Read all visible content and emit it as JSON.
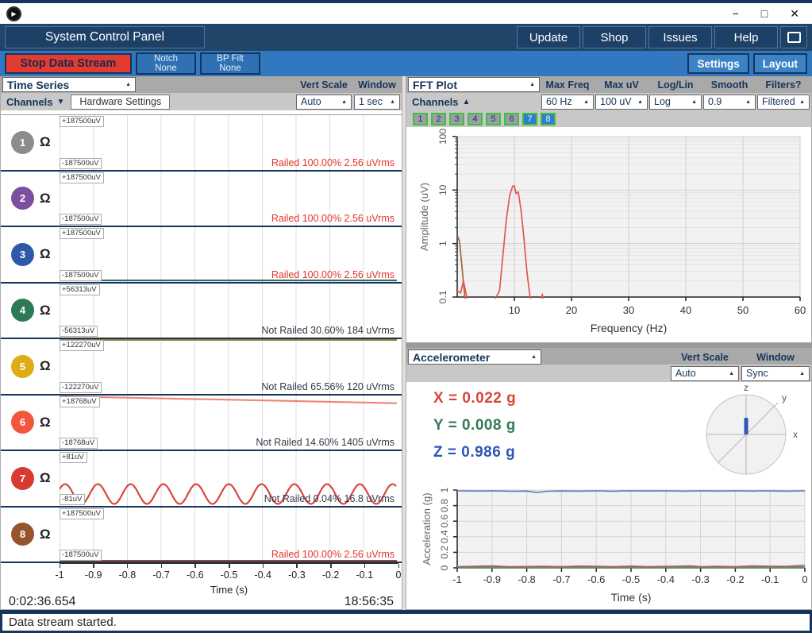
{
  "icons": {
    "play": "▶",
    "minimize": "−",
    "maximize": "□",
    "close": "✕",
    "arrow_up": "▲",
    "arrow_down": "▼",
    "ellipsis": "..."
  },
  "header": {
    "title": "System Control Panel",
    "buttons": [
      "Update",
      "Shop",
      "Issues",
      "Help"
    ]
  },
  "toolbar": {
    "stop_button": "Stop Data Stream",
    "notch_label": "Notch",
    "notch_value": "None",
    "bp_label": "BP Filt",
    "bp_value": "None",
    "settings": "Settings",
    "layout": "Layout"
  },
  "time_series": {
    "title": "Time Series",
    "vert_scale_label": "Vert Scale",
    "window_label": "Window",
    "vert_scale_value": "Auto",
    "window_value": "1 sec",
    "channels_label": "Channels",
    "hardware_settings": "Hardware Settings",
    "impedance_symbol": "Ω",
    "channels": [
      {
        "num": "1",
        "color": "#8c8c8c",
        "scale_top": "+187500uV",
        "scale_bottom": "-187500uV",
        "status": "Railed 100.00% 2.56 uVrms",
        "railed": true,
        "trace": {
          "type": "none",
          "color": "#16355a"
        }
      },
      {
        "num": "2",
        "color": "#7d4d9e",
        "scale_top": "+187500uV",
        "scale_bottom": "-187500uV",
        "status": "Railed 100.00% 2.56 uVrms",
        "railed": true,
        "trace": {
          "type": "none",
          "color": "#16355a"
        }
      },
      {
        "num": "3",
        "color": "#2c5aa8",
        "scale_top": "+187500uV",
        "scale_bottom": "-187500uV",
        "status": "Railed 100.00% 2.56 uVrms",
        "railed": true,
        "trace": {
          "type": "flat-bottom",
          "color": "#2d6d68"
        }
      },
      {
        "num": "4",
        "color": "#2c7a57",
        "scale_top": "+56313uV",
        "scale_bottom": "-56313uV",
        "status": "Not Railed 30.60% 184 uVrms",
        "railed": false,
        "trace": {
          "type": "none",
          "color": "#16355a"
        }
      },
      {
        "num": "5",
        "color": "#dfac17",
        "scale_top": "+122270uV",
        "scale_bottom": "-122270uV",
        "status": "Not Railed 65.56% 120 uVrms",
        "railed": false,
        "trace": {
          "type": "flat-top",
          "color": "#8f7d2a"
        }
      },
      {
        "num": "6",
        "color": "#f2573e",
        "scale_top": "+18768uV",
        "scale_bottom": "-18768uV",
        "status": "Not Railed 14.60% 1405 uVrms",
        "railed": false,
        "trace": {
          "type": "slope",
          "color": "#ef8673",
          "from": 1,
          "to": 10
        }
      },
      {
        "num": "7",
        "color": "#d63a32",
        "scale_top": "+81uV",
        "scale_bottom": "-81uV",
        "status": "Not Railed 0.04% 16.8 uVrms",
        "railed": false,
        "trace": {
          "type": "sine",
          "color": "#d8453c",
          "cycles": 10.3,
          "amplitude": 13,
          "baseline": 56,
          "phase": 0.5
        }
      },
      {
        "num": "8",
        "color": "#95542e",
        "scale_top": "+187500uV",
        "scale_bottom": "-187500uV",
        "status": "Railed 100.00% 2.56 uVrms",
        "railed": true,
        "trace": {
          "type": "flat-bottom",
          "color": "#8d4a2f"
        }
      }
    ],
    "x_ticks": [
      "-1",
      "-0.9",
      "-0.8",
      "-0.7",
      "-0.6",
      "-0.5",
      "-0.4",
      "-0.3",
      "-0.2",
      "-0.1",
      "0"
    ],
    "x_label": "Time (s)",
    "elapsed": "0:02:36.654",
    "clock": "18:56:35"
  },
  "fft": {
    "title": "FFT Plot",
    "channels_label": "Channels",
    "col_labels": [
      "Max Freq",
      "Max uV",
      "Log/Lin",
      "Smooth",
      "Filters?"
    ],
    "col_values": [
      "60 Hz",
      "100 uV",
      "Log",
      "0.9",
      "Filtered"
    ],
    "channel_buttons": [
      {
        "num": "1",
        "active": false
      },
      {
        "num": "2",
        "active": false
      },
      {
        "num": "3",
        "active": false
      },
      {
        "num": "4",
        "active": false
      },
      {
        "num": "5",
        "active": false
      },
      {
        "num": "6",
        "active": false
      },
      {
        "num": "7",
        "active": true
      },
      {
        "num": "8",
        "active": true
      }
    ]
  },
  "accel": {
    "title": "Accelerometer",
    "vert_scale_label": "Vert Scale",
    "window_label": "Window",
    "vert_scale_value": "Auto",
    "window_value": "Sync",
    "x_value": "X = 0.022 g",
    "y_value": "Y = 0.008 g",
    "z_value": "Z = 0.986 g",
    "axis_labels": {
      "x": "x",
      "y": "y",
      "z": "z"
    }
  },
  "status_bar": {
    "message": "Data stream started."
  },
  "chart_data": [
    {
      "id": "fft",
      "type": "line",
      "title": "FFT Plot",
      "xlabel": "Frequency (Hz)",
      "ylabel": "Amplitude (uV)",
      "xlim": [
        0,
        60
      ],
      "ylim": [
        0.1,
        100
      ],
      "yscale": "log",
      "x_ticks": [
        10,
        20,
        30,
        40,
        50,
        60
      ],
      "y_ticks": [
        0.1,
        1,
        10,
        100
      ],
      "series": [
        {
          "name": "channel-8",
          "color": "#a4673d",
          "points": [
            [
              0,
              1.45
            ],
            [
              0.4,
              1.1
            ],
            [
              0.8,
              0.4
            ],
            [
              1.2,
              0.14
            ],
            [
              1.5,
              0.07
            ]
          ]
        },
        {
          "name": "channel-7",
          "color": "#e2574e",
          "points": [
            [
              0,
              0.13
            ],
            [
              0.6,
              0.12
            ],
            [
              1.1,
              0.2
            ],
            [
              1.6,
              0.11
            ],
            [
              2,
              0.07
            ],
            [
              6.2,
              0.07
            ],
            [
              6.8,
              0.1
            ],
            [
              7.4,
              0.13
            ],
            [
              8,
              0.6
            ],
            [
              8.6,
              2.8
            ],
            [
              9.2,
              8
            ],
            [
              9.7,
              11.8
            ],
            [
              10,
              12
            ],
            [
              10.3,
              8.6
            ],
            [
              10.7,
              9.2
            ],
            [
              11.2,
              4
            ],
            [
              11.7,
              1.2
            ],
            [
              12.2,
              0.3
            ],
            [
              12.7,
              0.11
            ],
            [
              13.2,
              0.07
            ],
            [
              14.3,
              0.07
            ],
            [
              14.9,
              0.11
            ],
            [
              15.4,
              0.07
            ]
          ]
        }
      ]
    },
    {
      "id": "accel",
      "type": "line",
      "xlabel": "Time (s)",
      "ylabel": "Acceleration (g)",
      "xlim": [
        -1,
        0
      ],
      "ylim": [
        0,
        1
      ],
      "x_ticks": [
        -1,
        -0.9,
        -0.8,
        -0.7,
        -0.6,
        -0.5,
        -0.4,
        -0.3,
        -0.2,
        -0.1,
        0
      ],
      "y_ticks": [
        0,
        0.2,
        0.4,
        0.6,
        0.8,
        1
      ],
      "series": [
        {
          "name": "accel-y",
          "color": "#55917a",
          "width": 2.5,
          "points": [
            [
              -1,
              0.008
            ],
            [
              0,
              0.008
            ]
          ]
        },
        {
          "name": "accel-x",
          "color": "#c05048",
          "width": 1.5,
          "points": [
            [
              -1,
              0.015
            ],
            [
              -0.93,
              0.022
            ],
            [
              -0.9,
              0.025
            ],
            [
              -0.85,
              0.015
            ],
            [
              -0.75,
              0.02
            ],
            [
              -0.7,
              0.015
            ],
            [
              -0.65,
              0.022
            ],
            [
              -0.6,
              0.02
            ],
            [
              -0.55,
              0.015
            ],
            [
              -0.5,
              0.022
            ],
            [
              -0.45,
              0.015
            ],
            [
              -0.38,
              0.02
            ],
            [
              -0.33,
              0.025
            ],
            [
              -0.3,
              0.015
            ],
            [
              -0.25,
              0.02
            ],
            [
              -0.2,
              0.015
            ],
            [
              -0.15,
              0.025
            ],
            [
              -0.1,
              0.02
            ],
            [
              -0.05,
              0.02
            ],
            [
              0,
              0.035
            ]
          ]
        },
        {
          "name": "accel-z",
          "color": "#5a79c0",
          "width": 1.6,
          "points": [
            [
              -1,
              0.99
            ],
            [
              -0.93,
              0.987
            ],
            [
              -0.9,
              0.99
            ],
            [
              -0.84,
              0.985
            ],
            [
              -0.8,
              0.987
            ],
            [
              -0.77,
              0.968
            ],
            [
              -0.74,
              0.985
            ],
            [
              -0.7,
              0.988
            ],
            [
              -0.65,
              0.986
            ],
            [
              -0.6,
              0.99
            ],
            [
              -0.55,
              0.984
            ],
            [
              -0.52,
              0.99
            ],
            [
              -0.45,
              0.988
            ],
            [
              -0.4,
              0.99
            ],
            [
              -0.35,
              0.986
            ],
            [
              -0.3,
              0.99
            ],
            [
              -0.25,
              0.987
            ],
            [
              -0.2,
              0.99
            ],
            [
              -0.15,
              0.987
            ],
            [
              -0.12,
              0.99
            ],
            [
              -0.05,
              0.986
            ],
            [
              0,
              0.99
            ]
          ]
        }
      ]
    },
    {
      "id": "timeseries-channel-7",
      "type": "line",
      "description": "10 Hz sine wave, ~10.3 cycles over 1 s window, amplitude ~16.8 uVrms"
    }
  ]
}
